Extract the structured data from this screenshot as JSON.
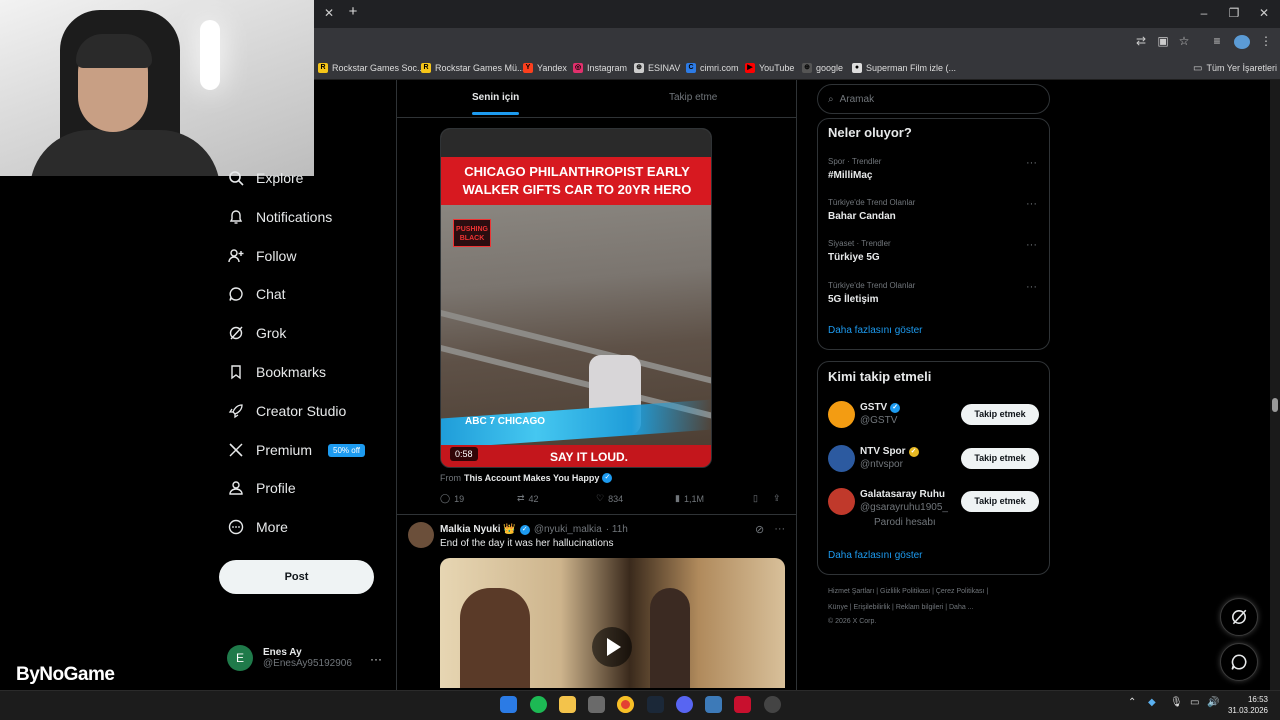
{
  "browser": {
    "bookmarks": [
      {
        "label": "Rockstar Games Soc...",
        "color": "#f5c518",
        "icon": "R"
      },
      {
        "label": "Rockstar Games Mü...",
        "color": "#f5c518",
        "icon": "R"
      },
      {
        "label": "Yandex",
        "color": "#fc3f1d",
        "icon": "Y"
      },
      {
        "label": "Instagram",
        "color": "#e1306c",
        "icon": "◎"
      },
      {
        "label": "ESINAV",
        "color": "#cccccc",
        "icon": "⊕"
      },
      {
        "label": "cimri.com",
        "color": "#2d7be5",
        "icon": "C"
      },
      {
        "label": "YouTube",
        "color": "#ff0000",
        "icon": "▶"
      },
      {
        "label": "google",
        "color": "#555555",
        "icon": "⊕"
      },
      {
        "label": "Superman Film izle (...",
        "color": "#dddddd",
        "icon": "●"
      }
    ],
    "all_bookmarks": "Tüm Yer İşaretleri"
  },
  "nav": {
    "explore": "Explore",
    "notifications": "Notifications",
    "follow": "Follow",
    "chat": "Chat",
    "grok": "Grok",
    "bookmarks": "Bookmarks",
    "creator_studio": "Creator Studio",
    "premium": "Premium",
    "premium_badge": "50% off",
    "profile": "Profile",
    "more": "More",
    "post": "Post"
  },
  "account": {
    "initial": "E",
    "name": "Enes Ay",
    "handle": "@EnesAy95192906",
    "more": "···"
  },
  "watermark": "ByNoGame",
  "feed": {
    "tab_for_you": "Senin için",
    "tab_following": "Takip etme",
    "post1": {
      "headline_line1": "CHICAGO PHILANTHROPIST EARLY",
      "headline_line2": "WALKER GIFTS CAR TO 20YR HERO",
      "logo_text": "PUSHING BLACK",
      "channel": "ABC 7 CHICAGO",
      "bottom_text": "SAY IT LOUD.",
      "duration": "0:58",
      "from_label": "From",
      "from_account": "This Account Makes You Happy",
      "replies": "19",
      "reposts": "42",
      "likes": "834",
      "views": "1,1M"
    },
    "post2": {
      "name": "Malkia Nyuki 👑",
      "handle": "@nyuki_malkia",
      "time": "· 11h",
      "text": "End of the day it was her hallucinations"
    }
  },
  "sidebar": {
    "search_placeholder": "Aramak",
    "trends_title": "Neler oluyor?",
    "trends": [
      {
        "meta": "Spor · Trendler",
        "name": "#MilliMaç"
      },
      {
        "meta": "Türkiye'de Trend Olanlar",
        "name": "Bahar Candan"
      },
      {
        "meta": "Siyaset · Trendler",
        "name": "Türkiye 5G"
      },
      {
        "meta": "Türkiye'de Trend Olanlar",
        "name": "5G İletişim"
      }
    ],
    "trends_more": "Daha fazlasını göster",
    "who_title": "Kimi takip etmeli",
    "who": [
      {
        "name": "GSTV",
        "handle": "@GSTV",
        "extra": "",
        "avatar_color": "#f39c12",
        "badge": "blue"
      },
      {
        "name": "NTV Spor",
        "handle": "@ntvspor",
        "extra": "",
        "avatar_color": "#2c5aa0",
        "badge": "gold"
      },
      {
        "name": "Galatasaray Ruhu",
        "handle": "@gsarayruhu1905_",
        "extra": "Parodi hesabı",
        "avatar_color": "#c0392b",
        "badge": ""
      }
    ],
    "follow_label": "Takip etmek",
    "who_more": "Daha fazlasını göster",
    "footer_line1": "Hizmet Şartları  |  Gizlilik Politikası  |  Çerez Politikası  |",
    "footer_line2": "Künye  |  Erişilebilirlik  |  Reklam bilgileri  |  Daha ...",
    "footer_line3": "© 2026 X Corp."
  },
  "taskbar": {
    "time": "16:53",
    "date": "31.03.2026"
  }
}
